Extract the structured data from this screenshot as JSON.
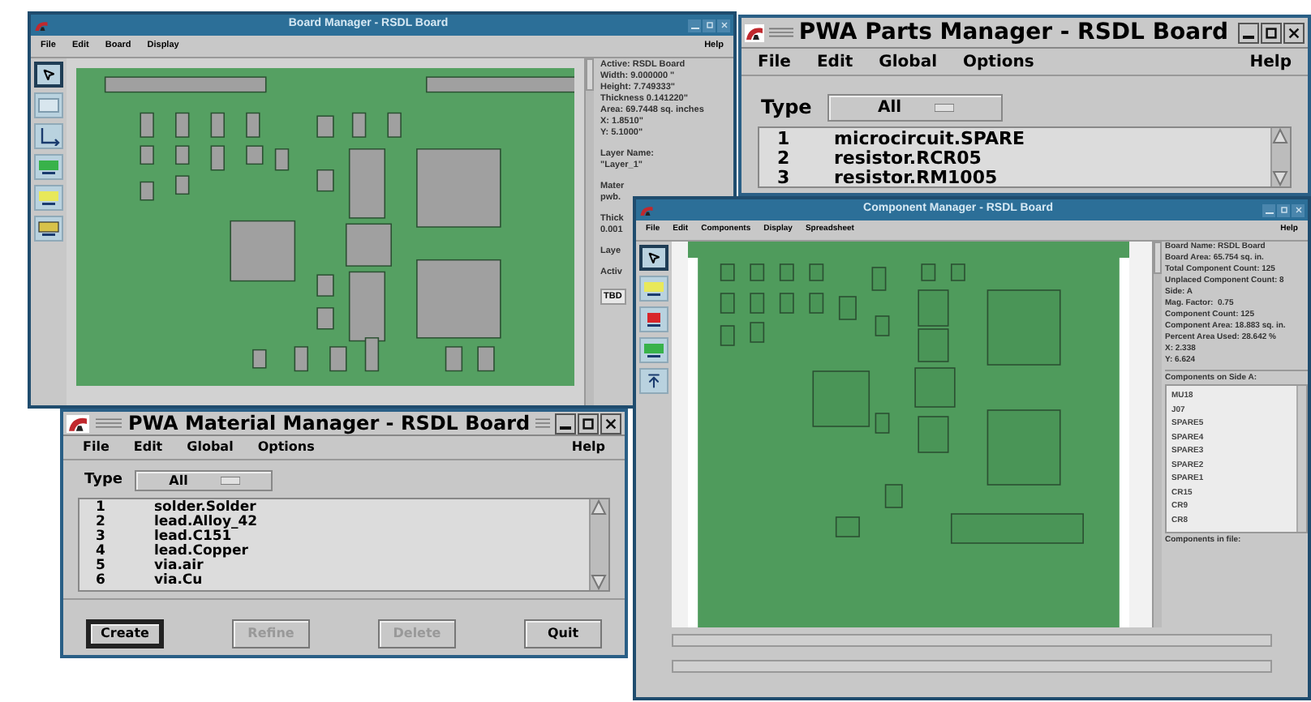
{
  "board_manager": {
    "title": "Board Manager - RSDL Board",
    "menu": [
      "File",
      "Edit",
      "Board",
      "Display"
    ],
    "help": "Help",
    "tools": [
      {
        "kind": "pointer",
        "selected": true
      },
      {
        "kind": "frame",
        "selected": false
      },
      {
        "kind": "axes",
        "selected": false
      },
      {
        "kind": "green",
        "selected": false
      },
      {
        "kind": "yellow",
        "selected": false
      },
      {
        "kind": "orange",
        "selected": false
      }
    ],
    "info_groups": [
      [
        "Active: RSDL Board",
        "Width: 9.000000 \"",
        "Height: 7.749333\"",
        "Thickness 0.141220\"",
        "Area: 69.7448 sq. inches",
        "X: 1.8510\"",
        "Y: 5.1000\""
      ],
      [
        "Layer Name:",
        "\"Layer_1\""
      ],
      [
        "Mater",
        "pwb."
      ],
      [
        "Thick",
        "0.001"
      ],
      [
        "Laye"
      ],
      [
        "Activ"
      ]
    ],
    "active_field": "TBD"
  },
  "parts_manager": {
    "title": "PWA Parts Manager - RSDL Board",
    "menu": [
      "File",
      "Edit",
      "Global",
      "Options"
    ],
    "help": "Help",
    "type_label": "Type",
    "type_value": "All",
    "rows": [
      {
        "number": "1",
        "name": "microcircuit.SPARE"
      },
      {
        "number": "2",
        "name": "resistor.RCR05"
      },
      {
        "number": "3",
        "name": "resistor.RM1005"
      }
    ]
  },
  "component_manager": {
    "title": "Component Manager - RSDL Board",
    "menu": [
      "File",
      "Edit",
      "Components",
      "Display",
      "Spreadsheet"
    ],
    "help": "Help",
    "tools": [
      {
        "kind": "pointer",
        "selected": true
      },
      {
        "kind": "yellow",
        "selected": false
      },
      {
        "kind": "red",
        "selected": false
      },
      {
        "kind": "green",
        "selected": false
      },
      {
        "kind": "up",
        "selected": false
      }
    ],
    "info": [
      "Board Name: RSDL Board",
      "Board Area: 65.754 sq. in.",
      "Total Component Count: 125",
      "Unplaced Component Count: 8",
      "Side: A",
      "Mag. Factor:  0.75",
      "Component Count: 125",
      "Component Area: 18.883 sq. in.",
      "Percent Area Used: 28.642 %",
      "X: 2.338",
      "Y: 6.624"
    ],
    "side_list_label": "Components on Side A:",
    "side_list": [
      "MU18",
      "J07",
      "SPARE5",
      "SPARE4",
      "SPARE3",
      "SPARE2",
      "SPARE1",
      "CR15",
      "CR9",
      "CR8"
    ],
    "file_list_label": "Components in file:"
  },
  "material_manager": {
    "title": "PWA Material Manager - RSDL Board",
    "menu": [
      "File",
      "Edit",
      "Global",
      "Options"
    ],
    "help": "Help",
    "type_label": "Type",
    "type_value": "All",
    "rows": [
      {
        "number": "1",
        "name": "solder.Solder"
      },
      {
        "number": "2",
        "name": "lead.Alloy_42"
      },
      {
        "number": "3",
        "name": "lead.C151"
      },
      {
        "number": "4",
        "name": "lead.Copper"
      },
      {
        "number": "5",
        "name": "via.air"
      },
      {
        "number": "6",
        "name": "via.Cu"
      }
    ],
    "buttons": [
      {
        "label": "Create",
        "disabled": false,
        "default": true
      },
      {
        "label": "Refine",
        "disabled": true,
        "default": false
      },
      {
        "label": "Delete",
        "disabled": true,
        "default": false
      },
      {
        "label": "Quit",
        "disabled": false,
        "default": false
      }
    ]
  }
}
